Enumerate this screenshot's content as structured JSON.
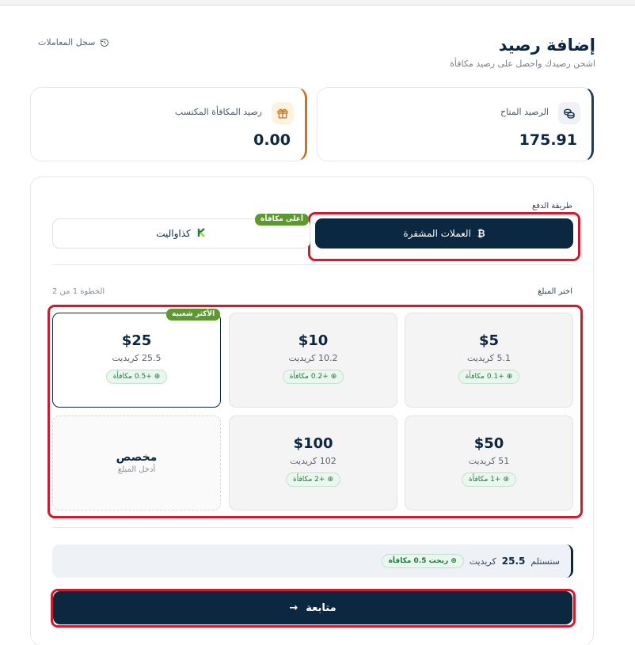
{
  "header": {
    "title": "إضافة رصيد",
    "subtitle": "اشحن رصيدك واحصل على رصيد مكافأة",
    "history_link": "سجل المعاملات"
  },
  "balances": {
    "available": {
      "label": "الرصيد المتاح",
      "value": "175.91",
      "icon": "coins-icon"
    },
    "reward": {
      "label": "رصيد المكافأة المكتسب",
      "value": "0.00",
      "icon": "gift-icon"
    }
  },
  "payment": {
    "label": "طريقة الدفع",
    "methods": [
      {
        "label": "العملات المشفرة",
        "icon": "bitcoin-icon",
        "selected": true
      },
      {
        "label": "كذاواليت",
        "icon": "wallet-logo-icon",
        "badge": "أعلى مكافأة",
        "selected": false
      }
    ]
  },
  "amounts": {
    "label": "اختر المبلغ",
    "step": "الخطوة 1 من 2",
    "options": [
      {
        "price": "$5",
        "credits": "5.1 كريديت",
        "bonus": "+0.1 مكافأة"
      },
      {
        "price": "$10",
        "credits": "10.2 كريديت",
        "bonus": "+0.2 مكافأة"
      },
      {
        "price": "$25",
        "credits": "25.5 كريديت",
        "bonus": "+0.5 مكافأة",
        "badge": "الأكثر شعبية",
        "selected": true
      },
      {
        "price": "$50",
        "credits": "51 كريديت",
        "bonus": "+1 مكافأة"
      },
      {
        "price": "$100",
        "credits": "102 كريديت",
        "bonus": "+2 مكافأة"
      }
    ],
    "custom": {
      "title": "مخصص",
      "subtitle": "أدخل المبلغ"
    }
  },
  "summary": {
    "receive_label": "ستستلم",
    "amount": "25.5",
    "unit": "كريديت",
    "bonus": "ربحت 0.5 مكافأة"
  },
  "continue_label": "متابعة",
  "colors": {
    "primary": "#0c2740",
    "accent_green": "#5c9a2f",
    "highlight_red": "#d3192b",
    "reward_orange": "#c2772b"
  }
}
